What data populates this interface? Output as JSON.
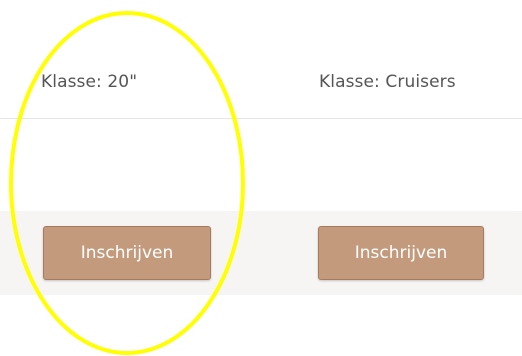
{
  "columns": [
    {
      "class_label": "Klasse: 20\"",
      "signup_label": "Inschrijven"
    },
    {
      "class_label": "Klasse: Cruisers",
      "signup_label": "Inschrijven"
    }
  ],
  "colors": {
    "button_fill": "#c49a7c",
    "button_border": "#a87b5d",
    "row_background": "#f7f5f3",
    "highlight_ellipse": "#ffff00"
  }
}
